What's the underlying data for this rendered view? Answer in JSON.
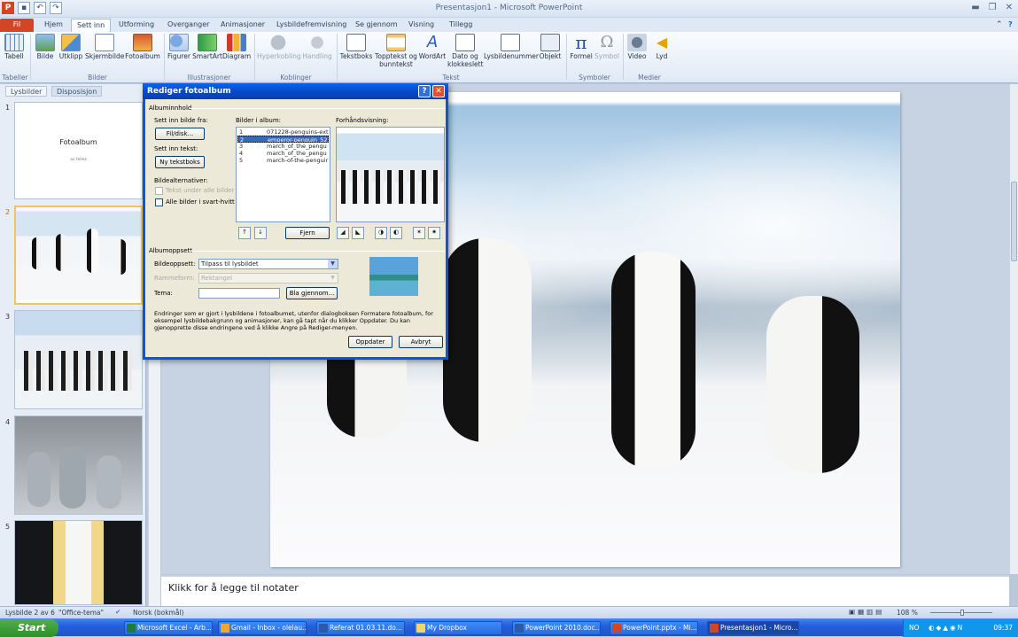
{
  "window": {
    "title": "Presentasjon1 - Microsoft PowerPoint"
  },
  "ribbon": {
    "tabs": [
      "Fil",
      "Hjem",
      "Sett inn",
      "Utforming",
      "Overganger",
      "Animasjoner",
      "Lysbildefremvisning",
      "Se gjennom",
      "Visning",
      "Tillegg"
    ],
    "active_tab": "Sett inn",
    "buttons": {
      "tabell": "Tabell",
      "bilde": "Bilde",
      "utklipp": "Utklipp",
      "skjermbilde": "Skjermbilde",
      "fotoalbum": "Fotoalbum",
      "figurer": "Figurer",
      "smartart": "SmartArt",
      "diagram": "Diagram",
      "hyperkobling": "Hyperkobling",
      "handling": "Handling",
      "tekstboks": "Tekstboks",
      "topptekst1": "Topptekst og",
      "topptekst2": "bunntekst",
      "wordart": "WordArt",
      "dato1": "Dato og",
      "dato2": "klokkeslett",
      "lysbildenummer": "Lysbildenummer",
      "objekt": "Objekt",
      "formel": "Formel",
      "symbol": "Symbol",
      "video": "Video",
      "lyd": "Lyd"
    },
    "groups": {
      "tabeller": "Tabeller",
      "bilder": "Bilder",
      "illustrasjoner": "Illustrasjoner",
      "koblinger": "Koblinger",
      "tekst": "Tekst",
      "symboler": "Symboler",
      "medier": "Medier"
    }
  },
  "left_panel": {
    "tabs": [
      "Lysbilder",
      "Disposisjon"
    ],
    "slides": [
      {
        "num": "1",
        "title": "Fotoalbum",
        "subtitle": "av fellez"
      },
      {
        "num": "2"
      },
      {
        "num": "3"
      },
      {
        "num": "4"
      },
      {
        "num": "5"
      }
    ]
  },
  "notes": {
    "placeholder": "Klikk for å legge til notater"
  },
  "status": {
    "slide": "Lysbilde 2 av 6",
    "theme": "\"Office-tema\"",
    "language": "Norsk (bokmål)",
    "zoom": "108 %"
  },
  "dialog": {
    "title": "Rediger fotoalbum",
    "section_content": "Albuminnhold",
    "insert_picture_from": "Sett inn bilde fra:",
    "file_disk_button": "Fil/disk...",
    "insert_text": "Sett inn tekst:",
    "new_textbox_button": "Ny tekstboks",
    "picture_options": "Bildealternativer:",
    "caption_below": "Tekst under alle bilder",
    "all_bw": "Alle bilder i svart-hvitt",
    "pictures_in_album": "Bilder i album:",
    "preview": "Forhåndsvisning:",
    "pictures": [
      {
        "n": "1",
        "name": "071228-penguins-ext"
      },
      {
        "n": "2",
        "name": "emperor-penguin_52"
      },
      {
        "n": "3",
        "name": "march_of_the_pengu"
      },
      {
        "n": "4",
        "name": "march_of_the_pengu"
      },
      {
        "n": "5",
        "name": "march-of-the-penguir"
      }
    ],
    "selected_index": 1,
    "remove_button": "Fjern",
    "section_layout": "Albumoppsett",
    "picture_layout_label": "Bildeoppsett:",
    "picture_layout_value": "Tilpass til lysbildet",
    "frame_shape_label": "Rammeform:",
    "frame_shape_value": "Rektangel",
    "theme_label": "Tema:",
    "theme_value": "",
    "browse_button": "Bla gjennom...",
    "note": "Endringer som er gjort i lysbildene i fotoalbumet, utenfor dialogboksen Formatere fotoalbum, for eksempel lysbildebakgrunn og animasjoner, kan gå tapt når du klikker Oppdater. Du kan gjenopprette disse endringene ved å klikke Angre på Rediger-menyen.",
    "update_button": "Oppdater",
    "cancel_button": "Avbryt",
    "help": "?",
    "close": "✕"
  },
  "taskbar": {
    "start": "Start",
    "items": [
      "Microsoft Excel - Arb...",
      "Gmail - Inbox - olelau...",
      "Referat 01.03.11.do...",
      "My Dropbox",
      "PowerPoint 2010.doc...",
      "PowerPoint.pptx - Mi...",
      "Presentasjon1 - Micro..."
    ],
    "lang": "NO",
    "time": "09:37"
  }
}
